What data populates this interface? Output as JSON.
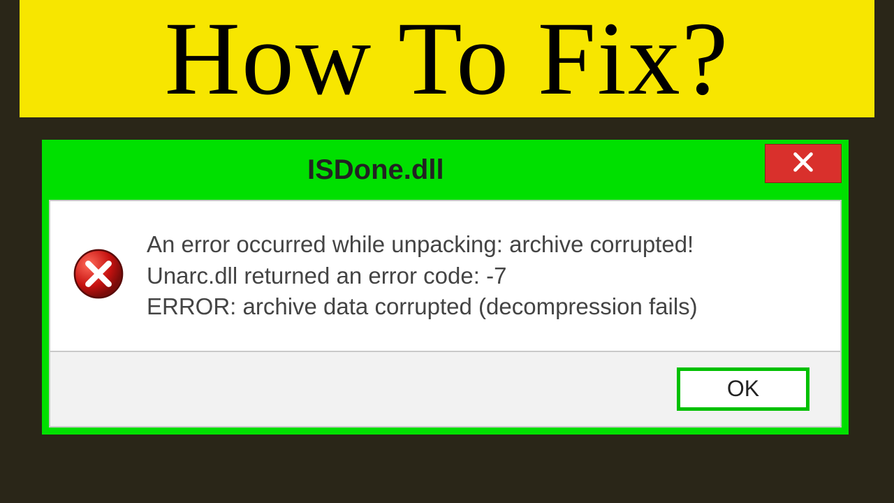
{
  "banner": {
    "text": "How To Fix?"
  },
  "dialog": {
    "title": "ISDone.dll",
    "close_icon": "close-icon",
    "message": {
      "line1": "An error occurred while unpacking: archive corrupted!",
      "line2": "Unarc.dll returned an error code: -7",
      "line3": "ERROR: archive data corrupted (decompression fails)"
    },
    "ok_label": "OK"
  }
}
